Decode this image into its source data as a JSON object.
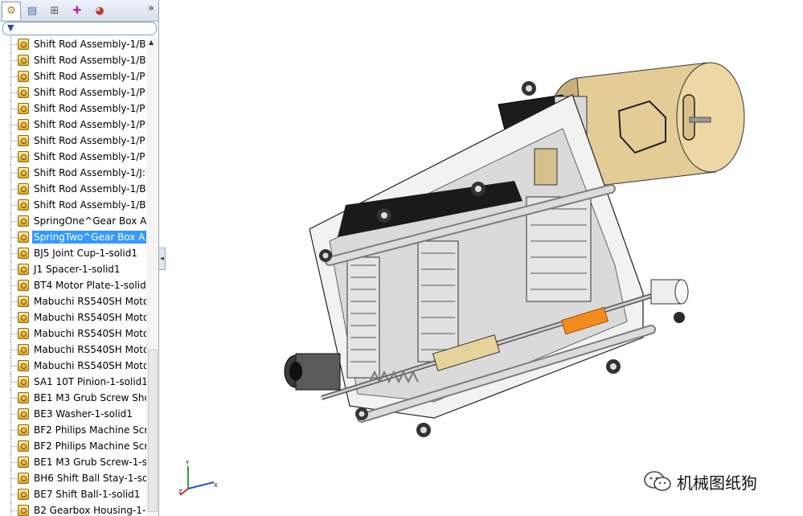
{
  "panel": {
    "tabs": [
      {
        "icon": "feature-manager-icon"
      },
      {
        "icon": "property-manager-icon"
      },
      {
        "icon": "configuration-manager-icon"
      },
      {
        "icon": "dimxpert-icon"
      },
      {
        "icon": "display-manager-icon"
      }
    ],
    "more_label": "»",
    "filter_icon": "filter-icon",
    "selected_index": 12,
    "items": [
      "Shift Rod Assembly-1/B",
      "Shift Rod Assembly-1/B",
      "Shift Rod Assembly-1/P",
      "Shift Rod Assembly-1/P",
      "Shift Rod Assembly-1/P",
      "Shift Rod Assembly-1/P",
      "Shift Rod Assembly-1/P",
      "Shift Rod Assembly-1/P",
      "Shift Rod Assembly-1/J:",
      "Shift Rod Assembly-1/B",
      "Shift Rod Assembly-1/B",
      "SpringOne^Gear Box A",
      "SpringTwo^Gear Box A",
      "BJ5 Joint Cup-1-solid1",
      "J1 Spacer-1-solid1",
      "BT4 Motor Plate-1-solid",
      "Mabuchi RS540SH Moto",
      "Mabuchi RS540SH Moto",
      "Mabuchi RS540SH Moto",
      "Mabuchi RS540SH Moto",
      "Mabuchi RS540SH Moto",
      "SA1 10T Pinion-1-solid1",
      "BE1 M3 Grub Screw Sho",
      "BE3 Washer-1-solid1",
      "BF2 Philips Machine Scr",
      "BF2 Philips Machine Scr",
      "BE1 M3 Grub Screw-1-s",
      "BH6 Shift Ball Stay-1-so",
      "BE7 Shift Ball-1-solid1",
      "B2 Gearbox Housing-1-"
    ]
  },
  "triad": {
    "x_label": "X",
    "y_label": "Y",
    "z_label": "Z"
  },
  "watermark": {
    "text": "机械图纸狗",
    "icon": "wechat-icon"
  },
  "colors": {
    "selection": "#3399ff",
    "motor_can": "#e3cc96",
    "gear": "#e4e4e4",
    "housing": "#f0f0f0",
    "accent_orange": "#f28a1e"
  }
}
